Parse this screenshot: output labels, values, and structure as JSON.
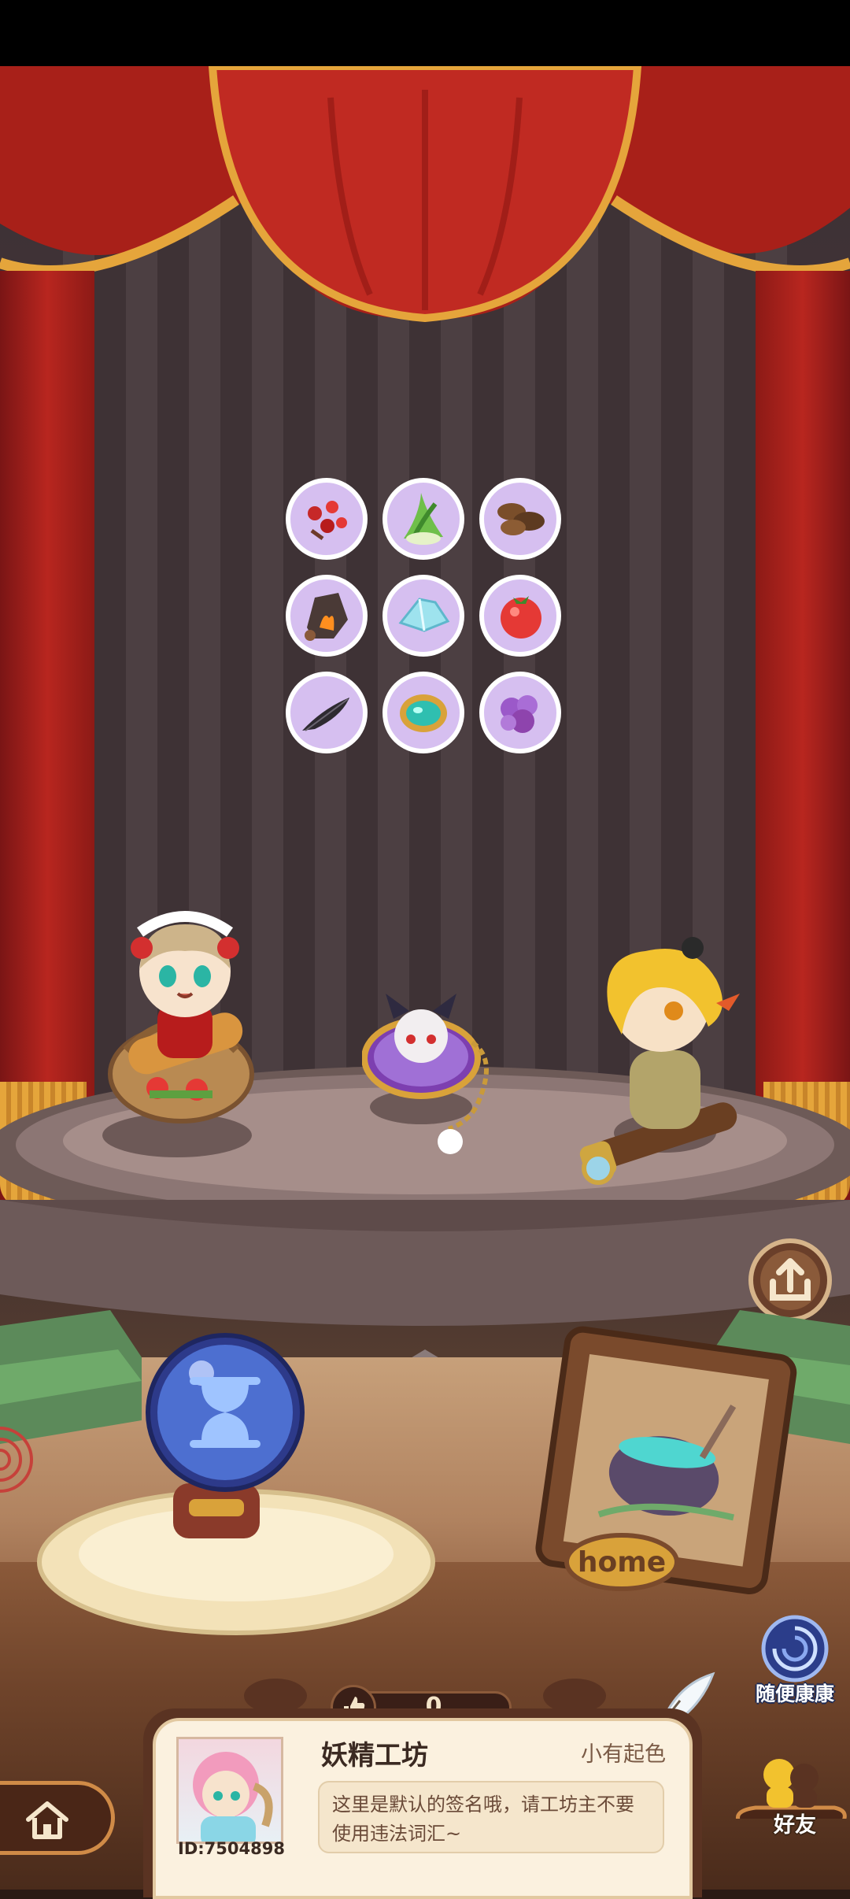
{
  "profile": {
    "workshop_name": "妖精工坊",
    "rank": "小有起色",
    "signature": "这里是默认的签名哦，请工坊主不要使用违法词汇~",
    "user_id": "ID:7504898"
  },
  "likes": {
    "count": "0"
  },
  "buttons": {
    "random_visit_label": "随便康康",
    "friends_label": "好友",
    "home_sign": "home"
  },
  "ingredients": [
    {
      "name": "red-berries"
    },
    {
      "name": "green-leek"
    },
    {
      "name": "brown-mushrooms"
    },
    {
      "name": "ember-rock"
    },
    {
      "name": "ice-crystal"
    },
    {
      "name": "red-tomato"
    },
    {
      "name": "dark-feather"
    },
    {
      "name": "teal-gem-ring"
    },
    {
      "name": "purple-coral"
    }
  ],
  "colors": {
    "curtain": "#b8261f",
    "fringe": "#e5a53b",
    "ingredient_bg": "#c7a6e4",
    "wood": "#6e432a",
    "paper": "#fbf1df",
    "orb": "#4d6fd0"
  }
}
